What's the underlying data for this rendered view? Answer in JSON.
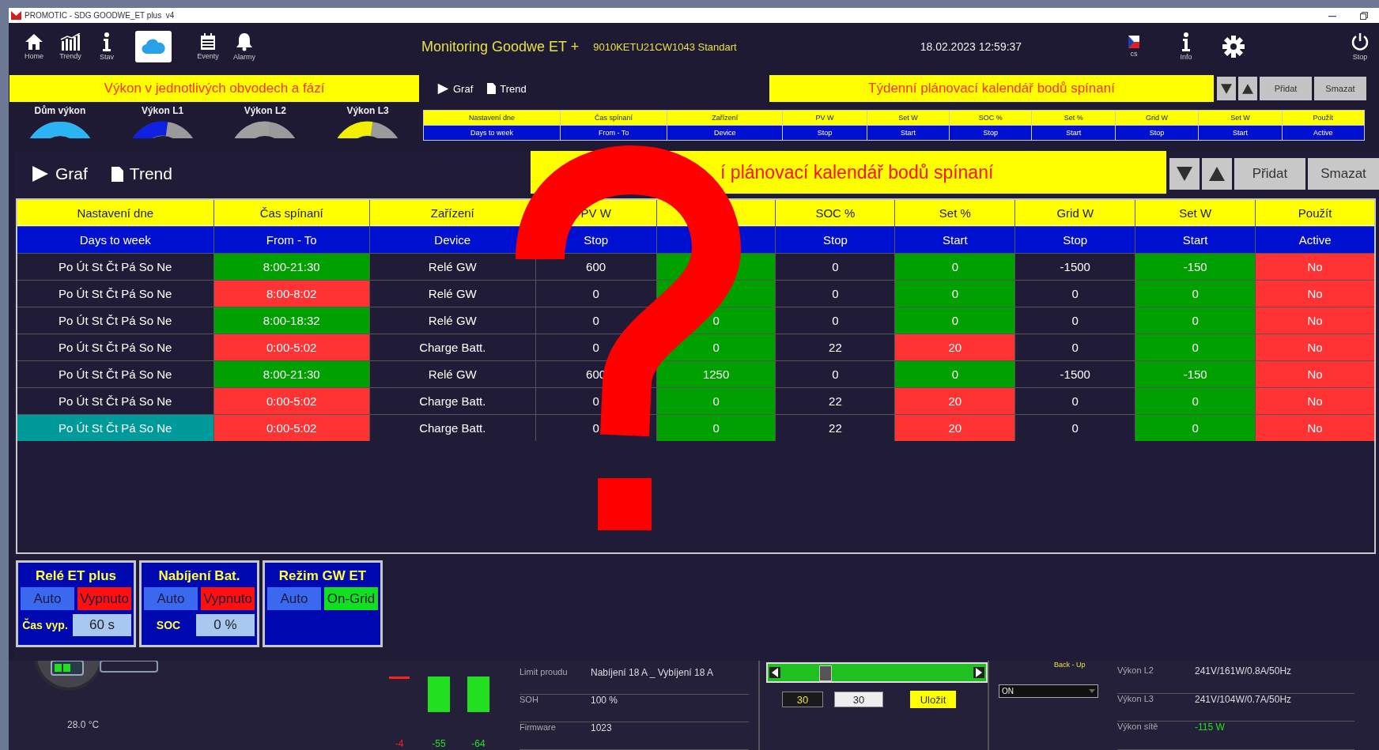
{
  "window": {
    "title": "PROMOTIC - SDG GOODWE_ET plus  v4",
    "controls": [
      {
        "kind": "minimize"
      },
      {
        "kind": "restore"
      }
    ]
  },
  "toolbar": {
    "buttons": [
      {
        "kind": "home",
        "label": "Home",
        "selected": false
      },
      {
        "kind": "trend",
        "label": "Trendy",
        "selected": false
      },
      {
        "kind": "info",
        "label": "Stav",
        "selected": false
      },
      {
        "kind": "cloud",
        "selected": true
      },
      {
        "kind": "events",
        "label": "Eventy",
        "selected": false
      },
      {
        "kind": "alarm",
        "label": "Alarmy",
        "selected": false
      }
    ],
    "title": "Monitoring Goodwe ET +",
    "subtitle": "9010KETU21CW1043 Standart",
    "datetime": "18.02.2023 12:59:37",
    "right_buttons": [
      {
        "kind": "flag",
        "label": "cs"
      },
      {
        "kind": "info",
        "label": "Info"
      },
      {
        "kind": "gear"
      },
      {
        "kind": "power",
        "label": "Stop"
      }
    ]
  },
  "power_panel": {
    "title": "Výkon v jednotlivých obvodech a fází",
    "gauges": [
      {
        "label": "Dům výkon",
        "color": "#2ab4f4"
      },
      {
        "label": "Výkon L1",
        "color": "#1020e0"
      },
      {
        "label": "Výkon L2",
        "color": "#a0a0a0"
      },
      {
        "label": "Výkon L3",
        "color": "#f0f000"
      }
    ]
  },
  "schedule_preview": {
    "view_tabs": [
      {
        "kind": "play",
        "label": "Graf"
      },
      {
        "kind": "doc",
        "label": "Trend"
      }
    ],
    "title": "Týdenní plánovací kalendář bodů spínaní",
    "controls": [
      {
        "kind": "down"
      },
      {
        "kind": "up"
      },
      {
        "kind": "text",
        "label": "Přidat"
      },
      {
        "kind": "text",
        "label": "Smazat"
      }
    ],
    "columns": [
      {
        "title": "Nastavení dne",
        "subtitle": "Days to week"
      },
      {
        "title": "Čas spínaní",
        "subtitle": "From - To"
      },
      {
        "title": "Zařízení",
        "subtitle": "Device"
      },
      {
        "title": "PV W",
        "subtitle": "Stop"
      },
      {
        "title": "Set W",
        "subtitle": "Start"
      },
      {
        "title": "SOC %",
        "subtitle": "Stop"
      },
      {
        "title": "Set %",
        "subtitle": "Start"
      },
      {
        "title": "Grid W",
        "subtitle": "Stop"
      },
      {
        "title": "Set W",
        "subtitle": "Start"
      },
      {
        "title": "Použít",
        "subtitle": "Active"
      }
    ]
  },
  "zoomed_schedule": {
    "view_tabs": [
      {
        "kind": "play",
        "label": "Graf"
      },
      {
        "kind": "doc",
        "label": "Trend"
      }
    ],
    "title": "í plánovací kalendář bodů spínaní",
    "controls": [
      {
        "kind": "down"
      },
      {
        "kind": "up"
      },
      {
        "kind": "text",
        "label": "Přidat"
      },
      {
        "kind": "text",
        "label": "Smazat"
      }
    ],
    "columns": [
      {
        "title": "Nastavení dne",
        "subtitle": "Days to week"
      },
      {
        "title": "Čas spínaní",
        "subtitle": "From - To"
      },
      {
        "title": "Zařízení",
        "subtitle": "Device"
      },
      {
        "title": "PV W",
        "subtitle": "Stop"
      },
      {},
      {
        "title": "SOC %",
        "subtitle": "Stop"
      },
      {
        "title": "Set %",
        "subtitle": "Start"
      },
      {
        "title": "Grid W",
        "subtitle": "Stop"
      },
      {
        "title": "Set W",
        "subtitle": "Start"
      },
      {
        "title": "Použít",
        "subtitle": "Active"
      }
    ],
    "rows": [
      {
        "selected": false,
        "cells": [
          {
            "text": "Po Út St Čt Pá So Ne"
          },
          {
            "text": "8:00-21:30",
            "color": "#00a000"
          },
          {
            "text": "Relé GW"
          },
          {
            "text": "600"
          },
          {
            "color": "#00a000"
          },
          {
            "text": "0"
          },
          {
            "text": "0",
            "color": "#00a000"
          },
          {
            "text": "-1500"
          },
          {
            "text": "-150",
            "color": "#00a000"
          },
          {
            "text": "No",
            "color": "#ff3333"
          }
        ]
      },
      {
        "selected": false,
        "cells": [
          {
            "text": "Po Út St Čt Pá So Ne"
          },
          {
            "text": "8:00-8:02",
            "color": "#ff3333"
          },
          {
            "text": "Relé GW"
          },
          {
            "text": "0"
          },
          {
            "color": "#00a000"
          },
          {
            "text": "0"
          },
          {
            "text": "0",
            "color": "#00a000"
          },
          {
            "text": "0"
          },
          {
            "text": "0",
            "color": "#00a000"
          },
          {
            "text": "No",
            "color": "#ff3333"
          }
        ]
      },
      {
        "selected": false,
        "cells": [
          {
            "text": "Po Út St Čt Pá So Ne"
          },
          {
            "text": "8:00-18:32",
            "color": "#00a000"
          },
          {
            "text": "Relé GW"
          },
          {
            "text": "0"
          },
          {
            "text": "0",
            "color": "#00a000"
          },
          {
            "text": "0"
          },
          {
            "text": "0",
            "color": "#00a000"
          },
          {
            "text": "0"
          },
          {
            "text": "0",
            "color": "#00a000"
          },
          {
            "text": "No",
            "color": "#ff3333"
          }
        ]
      },
      {
        "selected": false,
        "cells": [
          {
            "text": "Po Út St Čt Pá So Ne"
          },
          {
            "text": "0:00-5:02",
            "color": "#ff3333"
          },
          {
            "text": "Charge Batt."
          },
          {
            "text": "0"
          },
          {
            "text": "0",
            "color": "#00a000"
          },
          {
            "text": "22"
          },
          {
            "text": "20",
            "color": "#ff3333"
          },
          {
            "text": "0"
          },
          {
            "text": "0",
            "color": "#00a000"
          },
          {
            "text": "No",
            "color": "#ff3333"
          }
        ]
      },
      {
        "selected": false,
        "cells": [
          {
            "text": "Po Út St Čt Pá So Ne"
          },
          {
            "text": "8:00-21:30",
            "color": "#00a000"
          },
          {
            "text": "Relé GW"
          },
          {
            "text": "600"
          },
          {
            "text": "1250",
            "color": "#00a000"
          },
          {
            "text": "0"
          },
          {
            "text": "0",
            "color": "#00a000"
          },
          {
            "text": "-1500"
          },
          {
            "text": "-150",
            "color": "#00a000"
          },
          {
            "text": "No",
            "color": "#ff3333"
          }
        ]
      },
      {
        "selected": false,
        "cells": [
          {
            "text": "Po Út St Čt Pá So Ne"
          },
          {
            "text": "0:00-5:02",
            "color": "#ff3333"
          },
          {
            "text": "Charge Batt."
          },
          {
            "text": "0"
          },
          {
            "text": "0",
            "color": "#00a000"
          },
          {
            "text": "22"
          },
          {
            "text": "20",
            "color": "#ff3333"
          },
          {
            "text": "0"
          },
          {
            "text": "0",
            "color": "#00a000"
          },
          {
            "text": "No",
            "color": "#ff3333"
          }
        ]
      },
      {
        "selected": true,
        "cells": [
          {
            "text": "Po Út St Čt Pá So Ne"
          },
          {
            "text": "0:00-5:02",
            "color": "#ff3333"
          },
          {
            "text": "Charge Batt."
          },
          {
            "text": "0"
          },
          {
            "text": "0",
            "color": "#00a000"
          },
          {
            "text": "22"
          },
          {
            "text": "20",
            "color": "#ff3333"
          },
          {
            "text": "0"
          },
          {
            "text": "0",
            "color": "#00a000"
          },
          {
            "text": "No",
            "color": "#ff3333"
          }
        ]
      }
    ]
  },
  "mode_panels": [
    {
      "title": "Relé ET plus",
      "buttons": [
        {
          "label": "Auto",
          "color": "#3a68ee"
        },
        {
          "label": "Vypnuto",
          "color": "#ff1010"
        }
      ],
      "field": {
        "label": "Čas vyp.",
        "value": "60 s"
      }
    },
    {
      "title": "Nabíjení Bat.",
      "buttons": [
        {
          "label": "Auto",
          "color": "#3a68ee"
        },
        {
          "label": "Vypnuto",
          "color": "#ff1010"
        }
      ],
      "field": {
        "label": "SOC",
        "value": "0 %"
      }
    },
    {
      "title": "Režim GW ET",
      "buttons": [
        {
          "label": "Auto",
          "color": "#3a68ee"
        },
        {
          "label": "On-Grid",
          "color": "#10e020"
        }
      ]
    }
  ],
  "status_strip": {
    "temperature": "28.0 °C",
    "bars": [
      {
        "kind": "dash",
        "label": "-4",
        "color": "#ff2020"
      },
      {
        "kind": "bar",
        "label": "-55",
        "color": "#20e020"
      },
      {
        "kind": "bar",
        "label": "-64",
        "color": "#20e020"
      }
    ],
    "info_rows": [
      {
        "label": "Limit proudu",
        "value": "Nabíjení 18 A _ Vybíjení 18 A"
      },
      {
        "label": "SOH",
        "value": "100 %"
      },
      {
        "label": "Firmware",
        "value": "1023"
      }
    ],
    "slider": {
      "level": 0.26
    },
    "inputs": [
      {
        "kind": "dark",
        "value": "30"
      },
      {
        "kind": "light",
        "value": "30"
      }
    ],
    "save_button": "Uložit",
    "mode_label": "Back - Up",
    "dropdown": {
      "value": "ON"
    },
    "phase_rows": [
      {
        "label": "Výkon L2",
        "value": "241V/161W/0.8A/50Hz"
      },
      {
        "label": "Výkon L3",
        "value": "241V/104W/0.7A/50Hz"
      },
      {
        "label": "Výkon sítě",
        "value": "-115 W",
        "color": "#20e020"
      }
    ]
  }
}
